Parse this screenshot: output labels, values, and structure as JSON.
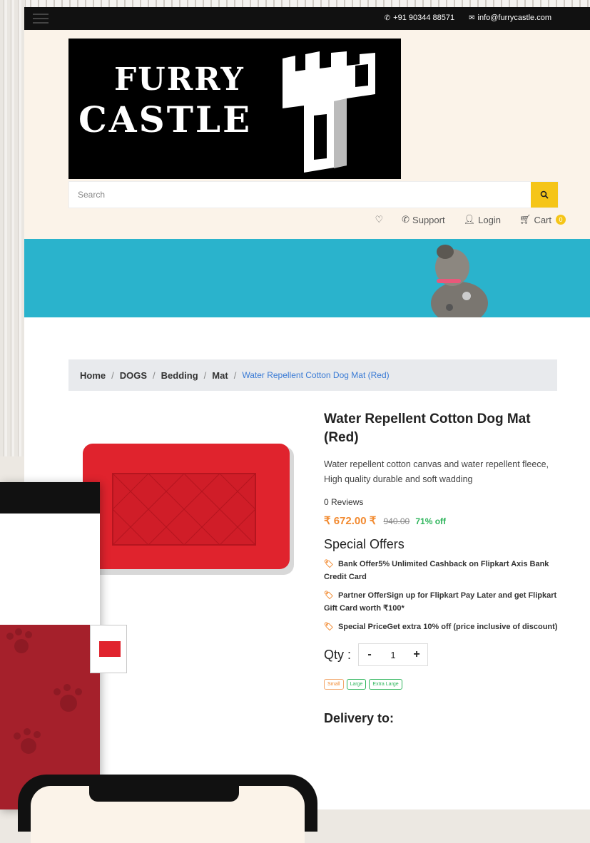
{
  "topbar": {
    "phone": "+91 90344 88571",
    "email": "info@furrycastle.com"
  },
  "logo": {
    "line1": "FURRY",
    "line2": "CASTLE"
  },
  "search": {
    "placeholder": "Search"
  },
  "nav": {
    "support": "Support",
    "login": "Login",
    "cart": "Cart",
    "cart_count": "0"
  },
  "breadcrumb": {
    "items": [
      "Home",
      "DOGS",
      "Bedding",
      "Mat"
    ],
    "current": "Water Repellent Cotton Dog Mat (Red)"
  },
  "product": {
    "title": "Water Repellent Cotton Dog Mat (Red)",
    "description": "Water repellent cotton canvas and water repellent fleece, High quality durable and soft wadding",
    "reviews": "0 Reviews",
    "price": "₹ 672.00 ₹",
    "mrp": "940.00",
    "discount": "71% off",
    "offers_heading": "Special Offers",
    "offers": [
      "Bank Offer5% Unlimited Cashback on Flipkart Axis Bank Credit Card",
      "Partner OfferSign up for Flipkart Pay Later and get Flipkart Gift Card worth ₹100*",
      "Special PriceGet extra 10% off (price inclusive of discount)"
    ],
    "qty_label": "Qty :",
    "qty_value": "1",
    "qty_minus": "-",
    "qty_plus": "+",
    "sizes": [
      "Small",
      "Large",
      "Extra Large"
    ],
    "delivery_heading": "Delivery to:"
  },
  "colors": {
    "accent": "#f5c518",
    "price": "#f28a30",
    "discount": "#2fb55c",
    "banner": "#2ab3cc",
    "mat": "#e0232d"
  }
}
